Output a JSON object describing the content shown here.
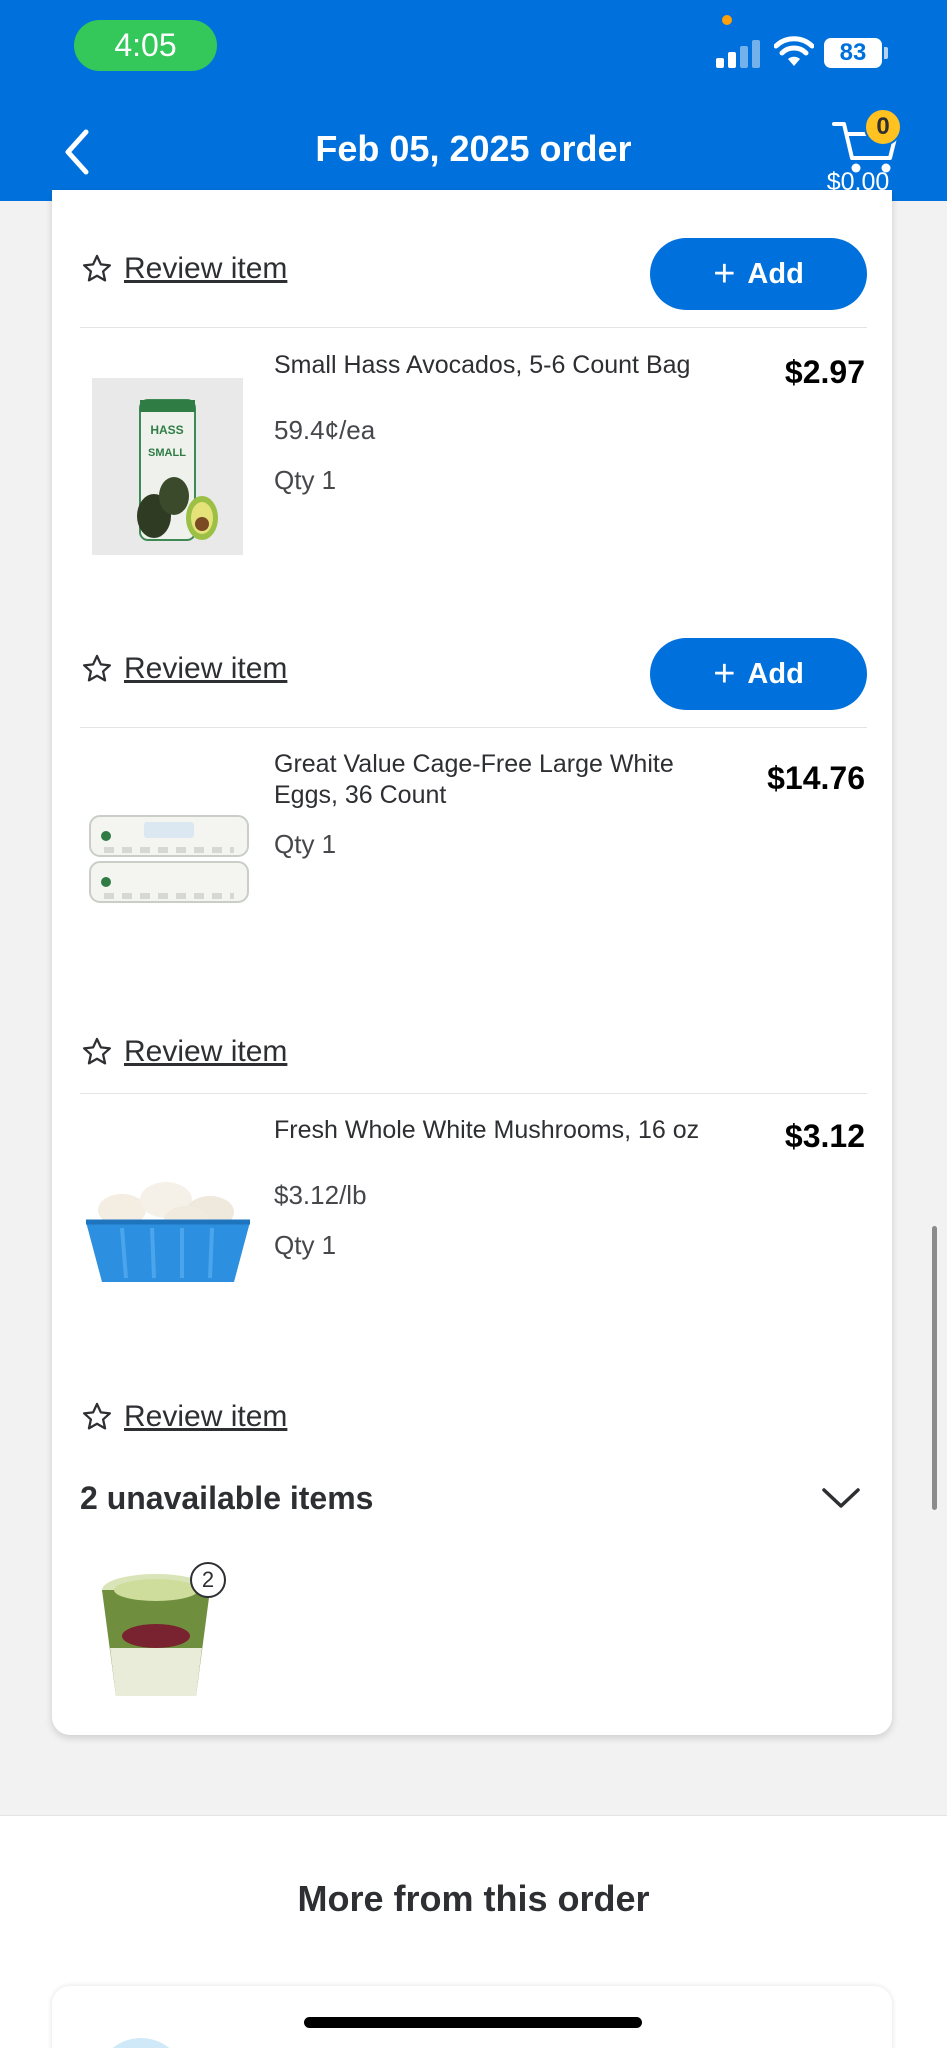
{
  "status_bar": {
    "time": "4:05",
    "battery": "83"
  },
  "header": {
    "title": "Feb 05, 2025 order",
    "cart_count": "0",
    "cart_total": "$0.00"
  },
  "items": [
    {
      "review_label": "Review item",
      "add_label": "Add",
      "name": "Small Hass Avocados, 5-6 Count Bag",
      "price": "$2.97",
      "unit_price": "59.4¢/ea",
      "qty": "Qty 1"
    },
    {
      "review_label": "Review item",
      "add_label": "Add",
      "name": "Great Value Cage-Free Large White Eggs, 36 Count",
      "price": "$14.76",
      "qty": "Qty 1"
    },
    {
      "review_label": "Review item",
      "name": "Fresh Whole White Mushrooms, 16 oz",
      "price": "$3.12",
      "unit_price": "$3.12/lb",
      "qty": "Qty 1"
    }
  ],
  "last_review_label": "Review item",
  "unavailable": {
    "title": "2 unavailable items",
    "count_badge": "2"
  },
  "more": {
    "title": "More from this order"
  },
  "colors": {
    "brand_blue": "#0071dc",
    "status_green": "#34c759",
    "badge_yellow": "#ffc220"
  }
}
